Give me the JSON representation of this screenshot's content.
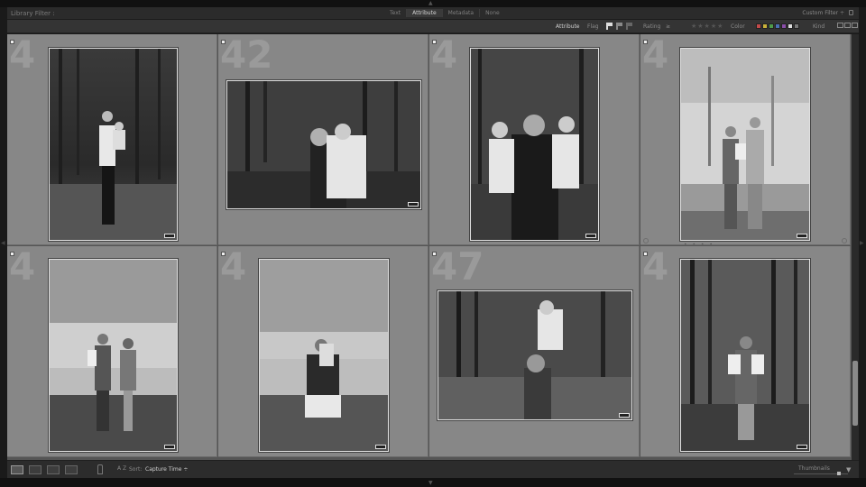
{
  "filter_bar": {
    "title": "Library Filter :",
    "tabs": [
      "Text",
      "Attribute",
      "Metadata",
      "None"
    ],
    "active_tab": "Attribute",
    "preset": "Custom Filter ÷"
  },
  "attribute_bar": {
    "attribute_label": "Attribute",
    "flag_label": "Flag",
    "rating_label": "Rating",
    "rating_op": "≥",
    "stars": "★★★★★",
    "color_label": "Color",
    "colors": [
      "#c24a4a",
      "#c9b13a",
      "#4e9a4a",
      "#4a6fb3",
      "#8a4ea8",
      "#dddddd",
      "#777777"
    ],
    "kind_label": "Kind"
  },
  "grid": {
    "cells": [
      {
        "index": "4",
        "photo": "mother-father-baby-forest-1"
      },
      {
        "index": "42",
        "photo": "mother-baby-forest-2"
      },
      {
        "index": "4",
        "photo": "mother-twins-forest-3"
      },
      {
        "index": "4",
        "photo": "family-park-4"
      },
      {
        "index": "4",
        "photo": "family-walk-5"
      },
      {
        "index": "4",
        "photo": "mother-baby-field-6"
      },
      {
        "index": "47",
        "photo": "mother-lifting-baby-7"
      },
      {
        "index": "4",
        "photo": "mother-baby-woods-8"
      }
    ],
    "card_dots": "• • • •"
  },
  "toolbar": {
    "view_buttons": [
      "grid-view",
      "loupe-view",
      "compare-view",
      "survey-view"
    ],
    "az_label": "A Z",
    "sort_label": "Sort:",
    "sort_value": "Capture Time ÷",
    "thumbnails_label": "Thumbnails",
    "thumbnail_size_fraction": 0.85
  }
}
